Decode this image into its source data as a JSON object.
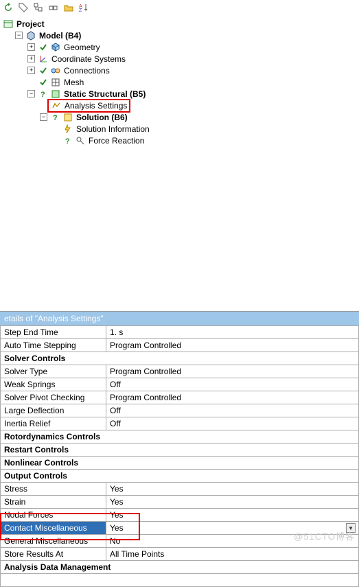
{
  "tree": {
    "root": "Project",
    "model": "Model (B4)",
    "geometry": "Geometry",
    "coord": "Coordinate Systems",
    "connections": "Connections",
    "mesh": "Mesh",
    "static": "Static Structural (B5)",
    "analysis_settings": "Analysis Settings",
    "solution": "Solution (B6)",
    "solution_info": "Solution Information",
    "force_reaction": "Force Reaction"
  },
  "details_title": "etails of \"Analysis Settings\"",
  "rows": {
    "step_end_time": {
      "label": "Step End Time",
      "value": "1. s"
    },
    "auto_time_stepping": {
      "label": "Auto Time Stepping",
      "value": "Program Controlled"
    },
    "section_solver": "Solver Controls",
    "solver_type": {
      "label": "Solver Type",
      "value": "Program Controlled"
    },
    "weak_springs": {
      "label": "Weak Springs",
      "value": "Off"
    },
    "solver_pivot": {
      "label": "Solver Pivot Checking",
      "value": "Program Controlled"
    },
    "large_deflection": {
      "label": "Large Deflection",
      "value": "Off"
    },
    "inertia_relief": {
      "label": "Inertia Relief",
      "value": "Off"
    },
    "section_rotor": "Rotordynamics Controls",
    "section_restart": "Restart Controls",
    "section_nonlinear": "Nonlinear Controls",
    "section_output": "Output Controls",
    "stress": {
      "label": "Stress",
      "value": "Yes"
    },
    "strain": {
      "label": "Strain",
      "value": "Yes"
    },
    "nodal_forces": {
      "label": "Nodal Forces",
      "value": "Yes"
    },
    "contact_misc": {
      "label": "Contact Miscellaneous",
      "value": "Yes"
    },
    "general_misc": {
      "label": "General Miscellaneous",
      "value": "No"
    },
    "store_results": {
      "label": "Store Results At",
      "value": "All Time Points"
    },
    "section_adm": "Analysis Data Management"
  },
  "watermark": "@51CTO博客"
}
